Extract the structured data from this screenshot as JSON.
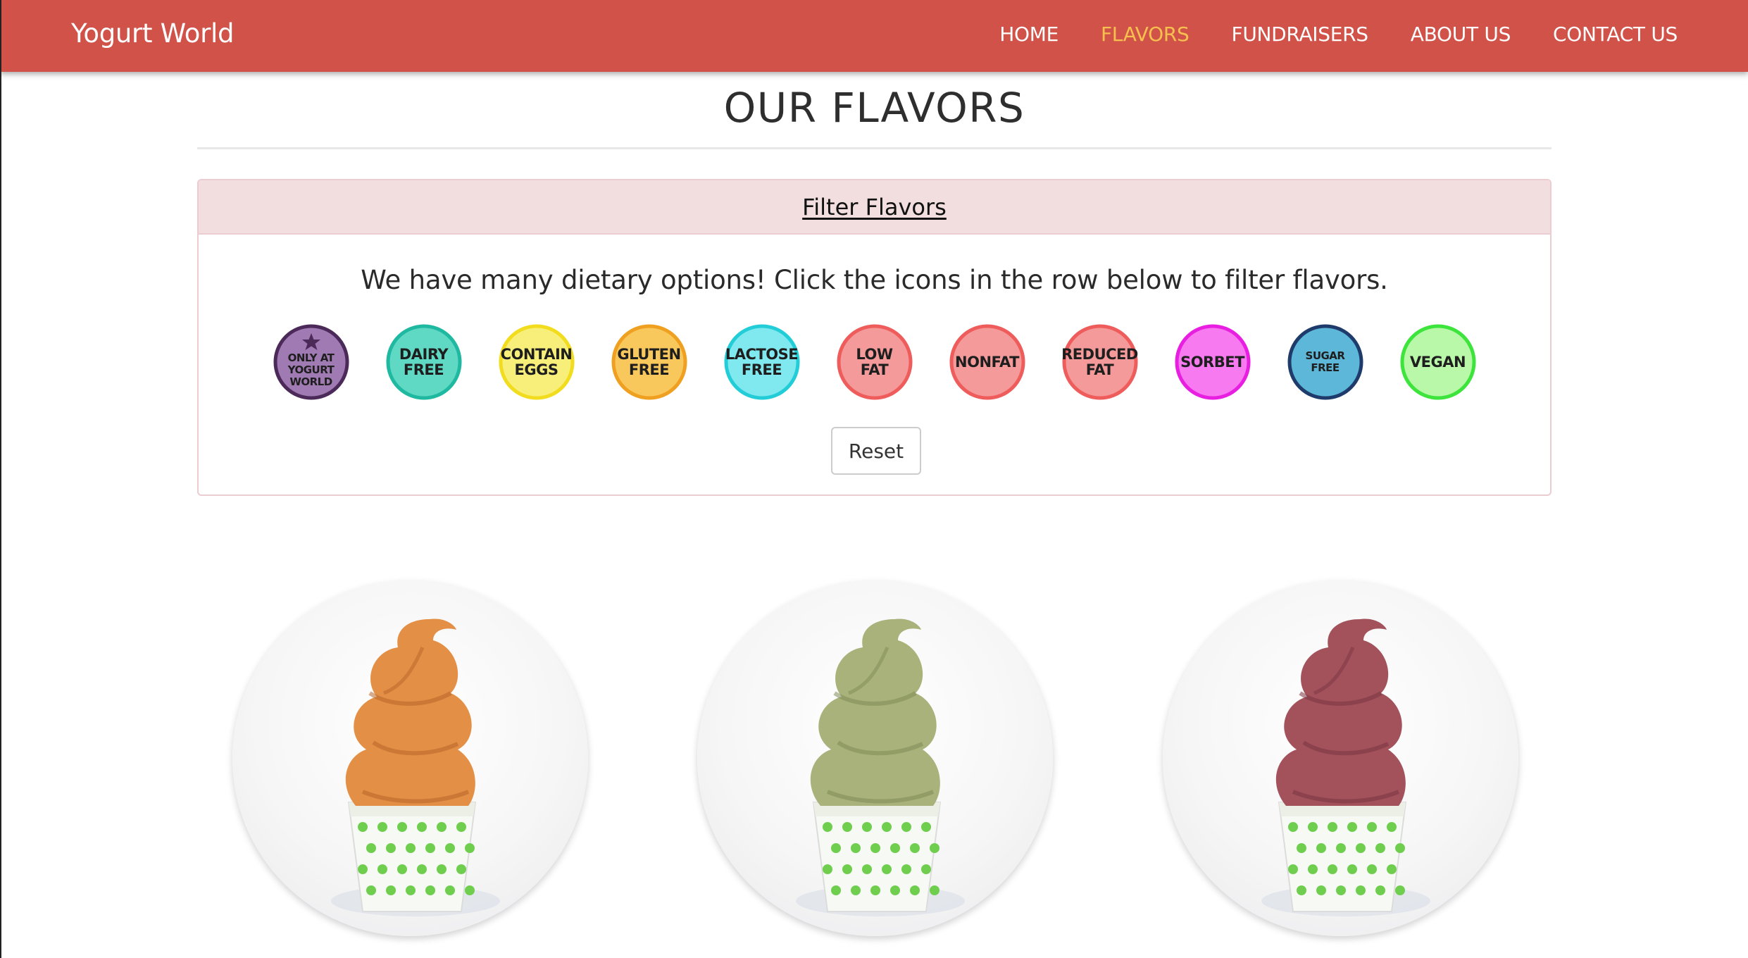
{
  "nav": {
    "brand": "Yogurt World",
    "links": [
      "HOME",
      "FLAVORS",
      "FUNDRAISERS",
      "ABOUT US",
      "CONTACT US"
    ],
    "active": "FLAVORS",
    "colors": {
      "bar": "#d15248",
      "active": "#f6c04f"
    }
  },
  "page": {
    "title": "OUR FLAVORS"
  },
  "filter": {
    "heading": "Filter Flavors",
    "intro": "We have many dietary options! Click the icons in the row below to filter flavors.",
    "icons": [
      {
        "name": "only-at-yogurt-world",
        "lines": [
          "ONLY AT",
          "YOGURT",
          "WORLD"
        ],
        "color": "#a07ab3",
        "ring": "#4b2a5a"
      },
      {
        "name": "dairy-free",
        "lines": [
          "DAIRY",
          "FREE"
        ],
        "color": "#5fd9c4",
        "ring": "#1fb8a0"
      },
      {
        "name": "contain-eggs",
        "lines": [
          "CONTAIN",
          "EGGS"
        ],
        "color": "#f8ef7a",
        "ring": "#f2dc1e"
      },
      {
        "name": "gluten-free",
        "lines": [
          "GLUTEN",
          "FREE"
        ],
        "color": "#f9c85c",
        "ring": "#f0a020"
      },
      {
        "name": "lactose-free",
        "lines": [
          "LACTOSE",
          "FREE"
        ],
        "color": "#7fe9ef",
        "ring": "#22cdd8"
      },
      {
        "name": "low-fat",
        "lines": [
          "LOW",
          "FAT"
        ],
        "color": "#f59a9a",
        "ring": "#ee5c5c"
      },
      {
        "name": "nonfat",
        "lines": [
          "NONFAT"
        ],
        "color": "#f59a9a",
        "ring": "#ee5c5c"
      },
      {
        "name": "reduced-fat",
        "lines": [
          "REDUCED",
          "FAT"
        ],
        "color": "#f59a9a",
        "ring": "#ee5c5c"
      },
      {
        "name": "sorbet",
        "lines": [
          "SORBET"
        ],
        "color": "#f77af0",
        "ring": "#e81ee0"
      },
      {
        "name": "sugar-free",
        "lines": [
          "SUGAR",
          "FREE"
        ],
        "color": "#5db7d8",
        "ring": "#1f3b6b"
      },
      {
        "name": "vegan",
        "lines": [
          "VEGAN"
        ],
        "color": "#b8f8a8",
        "ring": "#3ce43c"
      }
    ],
    "reset": "Reset"
  },
  "flavors": [
    {
      "name": "orange-flavor",
      "color": "#e38f45",
      "shade": "#b8662c"
    },
    {
      "name": "green-flavor",
      "color": "#a9b27a",
      "shade": "#7f8a55"
    },
    {
      "name": "berry-flavor",
      "color": "#a3525c",
      "shade": "#7a3440"
    }
  ]
}
